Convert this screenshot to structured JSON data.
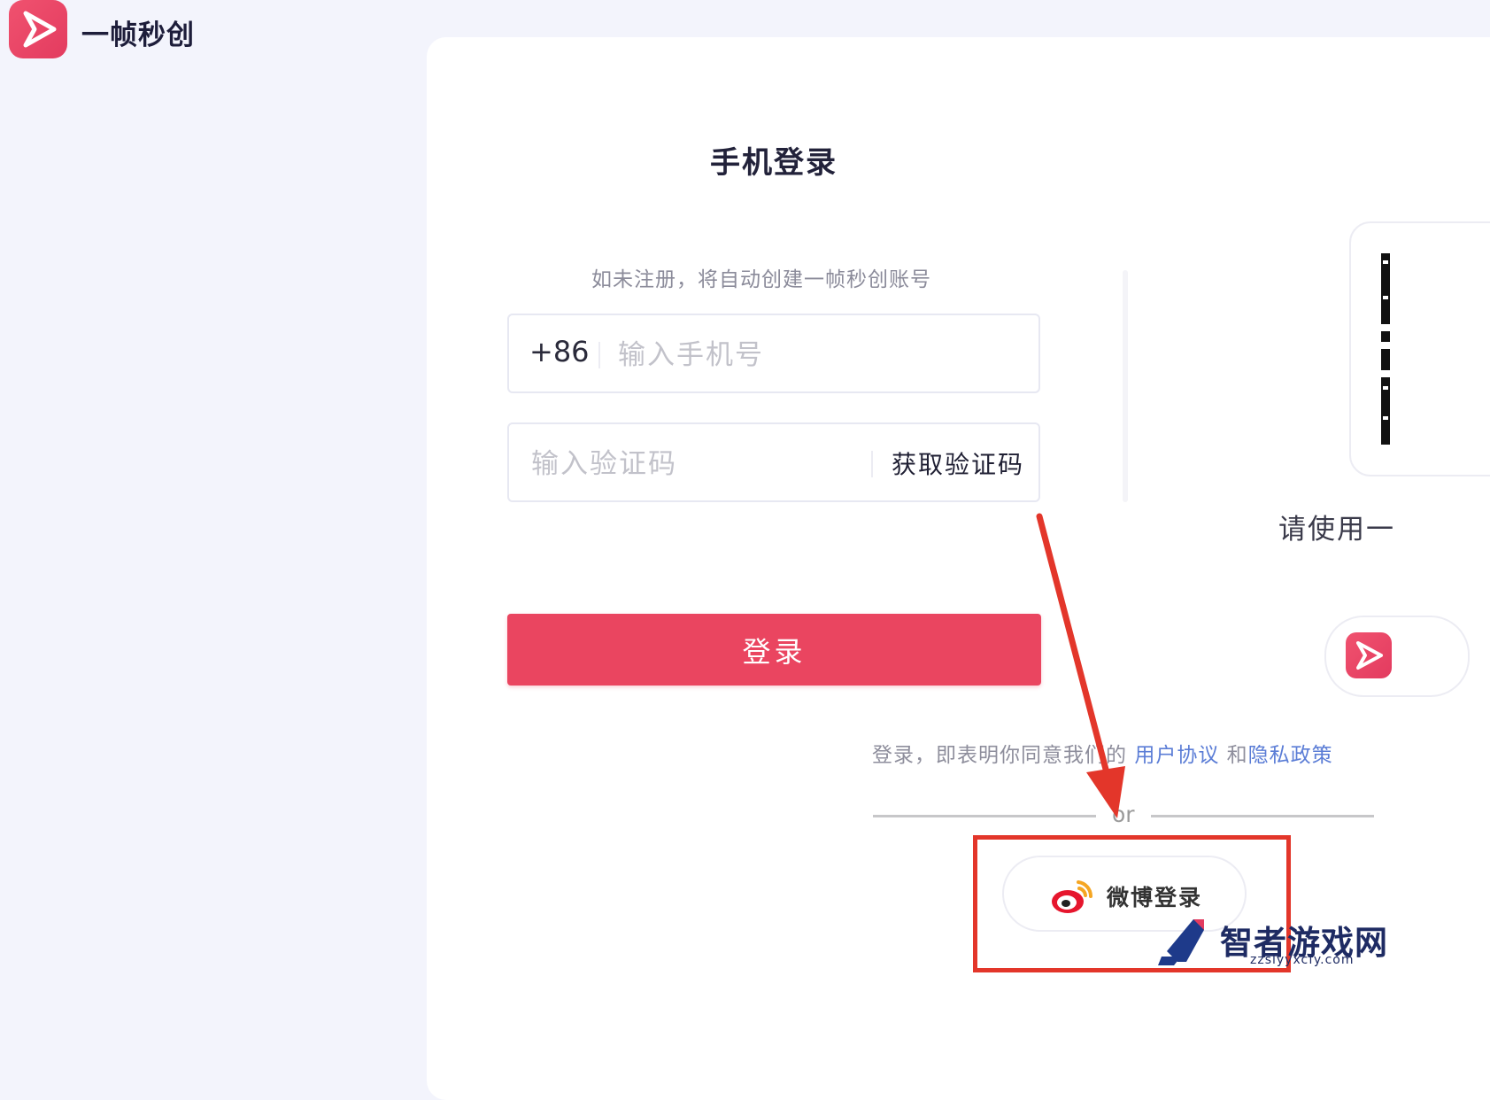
{
  "brand": {
    "name": "一帧秒创",
    "logo_icon": "paper-plane-icon"
  },
  "login": {
    "title": "手机登录",
    "hint": "如未注册，将自动创建一帧秒创账号",
    "phone": {
      "prefix": "+86",
      "placeholder": "输入手机号",
      "value": ""
    },
    "code": {
      "placeholder": "输入验证码",
      "value": "",
      "get_code_label": "获取验证码"
    },
    "submit_label": "登录",
    "accent_color": "#ea4560"
  },
  "qr": {
    "hint": "请使用一"
  },
  "agreement": {
    "prefix": "登录，即表明你同意我们的",
    "user_agreement": "用户协议",
    "and": "和",
    "privacy_policy": "隐私政策",
    "link_color": "#5b7dd6"
  },
  "divider": {
    "text": "or"
  },
  "weibo": {
    "label": "微博登录",
    "icon": "weibo-icon"
  },
  "annotation": {
    "box_color": "#e3362a",
    "arrow_color": "#e3362a"
  },
  "watermark": {
    "title": "智者游戏网",
    "url": "zzslyyxcfy.com"
  }
}
